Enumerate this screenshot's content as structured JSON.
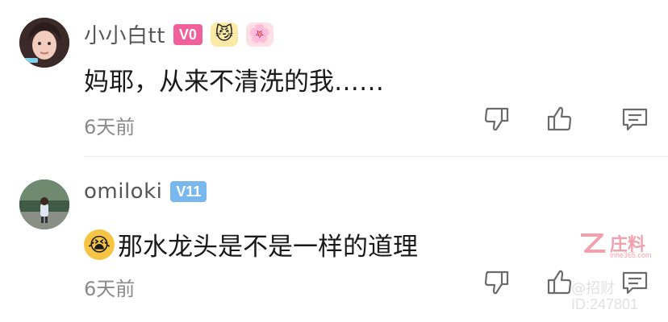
{
  "comments": [
    {
      "username": "小小白tt",
      "level": "V0",
      "level_color": "#f0609a",
      "badges": [
        "crown-mask-badge-icon",
        "cherry-blossom-badge-icon"
      ],
      "text": "妈耶，从来不清洗的我……",
      "time": "6天前"
    },
    {
      "username": "omiloki",
      "level": "V11",
      "level_color": "#79b8ef",
      "emoji": "😭",
      "text": "那水龙头是不是一样的道理",
      "time": "6天前"
    }
  ],
  "actions": {
    "dislike_icon": "thumbs-down-icon",
    "like_icon": "thumbs-up-icon",
    "reply_icon": "comment-icon"
  },
  "watermark": {
    "brand": "庄料",
    "site": "lnhe365.com",
    "line1": "@招财",
    "line2": "ID:247801"
  }
}
